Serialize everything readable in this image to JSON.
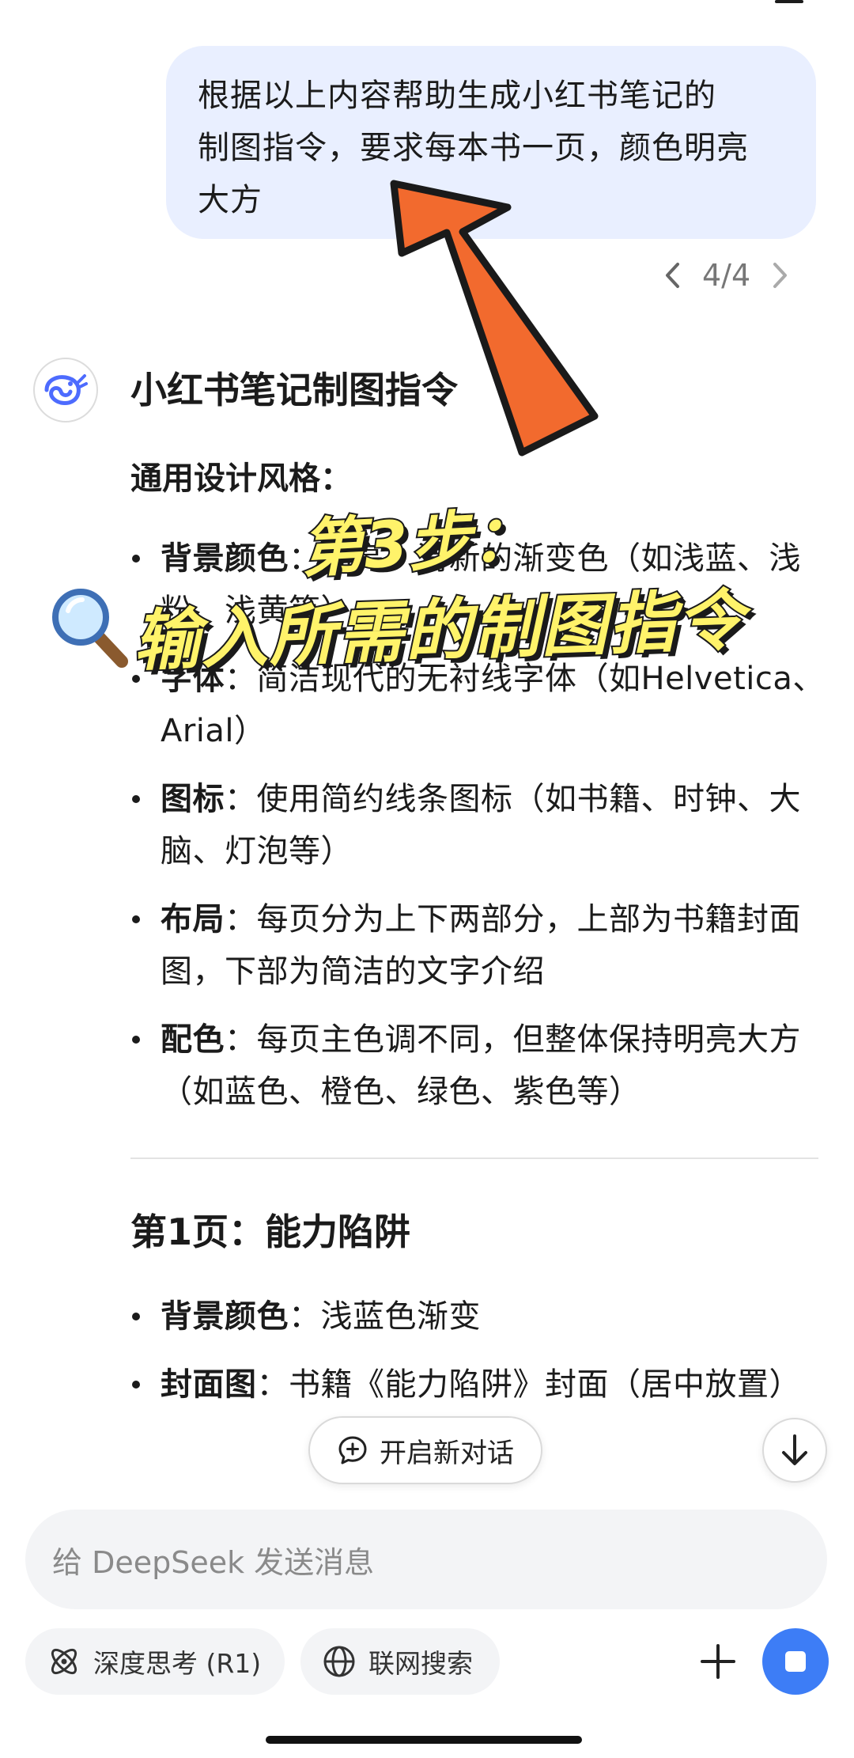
{
  "user_message": {
    "lines": [
      "根据以上内容帮助生成小红书笔记的",
      "制图指令，要求每本书一页，颜色明亮",
      "大方"
    ],
    "pager": "4/4"
  },
  "response": {
    "title": "小红书笔记制图指令",
    "general_heading": "通用设计风格：",
    "general_items": [
      {
        "label": "背景颜色",
        "text": "：明亮、清新的渐变色（如浅蓝、浅粉、浅黄等）"
      },
      {
        "label": "字体",
        "text": "：简洁现代的无衬线字体（如Helvetica、Arial）"
      },
      {
        "label": "图标",
        "text": "：使用简约线条图标（如书籍、时钟、大脑、灯泡等）"
      },
      {
        "label": "布局",
        "text": "：每页分为上下两部分，上部为书籍封面图，下部为简洁的文字介绍"
      },
      {
        "label": "配色",
        "text": "：每页主色调不同，但整体保持明亮大方（如蓝色、橙色、绿色、紫色等）"
      }
    ],
    "page1_heading": "第1页：能力陷阱",
    "page1_items": [
      {
        "label": "背景颜色",
        "text": "：浅蓝色渐变"
      },
      {
        "label": "封面图",
        "text": "：书籍《能力陷阱》封面（居中放置）"
      }
    ]
  },
  "buttons": {
    "new_chat": "开启新对话"
  },
  "composer": {
    "placeholder": "给 DeepSeek 发送消息",
    "deep_think": "深度思考 (R1)",
    "web_search": "联网搜索"
  },
  "overlay": {
    "step_caption": "第3步：",
    "main_caption": "输入所需的制图指令"
  },
  "colors": {
    "accent": "#3d7df6",
    "bubble": "#e9efff",
    "arrow": "#f26a2e",
    "caption": "#fff36a"
  },
  "icons": [
    "deepseek-whale-icon",
    "chevron-left-icon",
    "chevron-right-icon",
    "new-chat-icon",
    "arrow-down-icon",
    "atom-icon",
    "globe-icon",
    "plus-icon",
    "stop-icon",
    "magnifier-icon"
  ]
}
